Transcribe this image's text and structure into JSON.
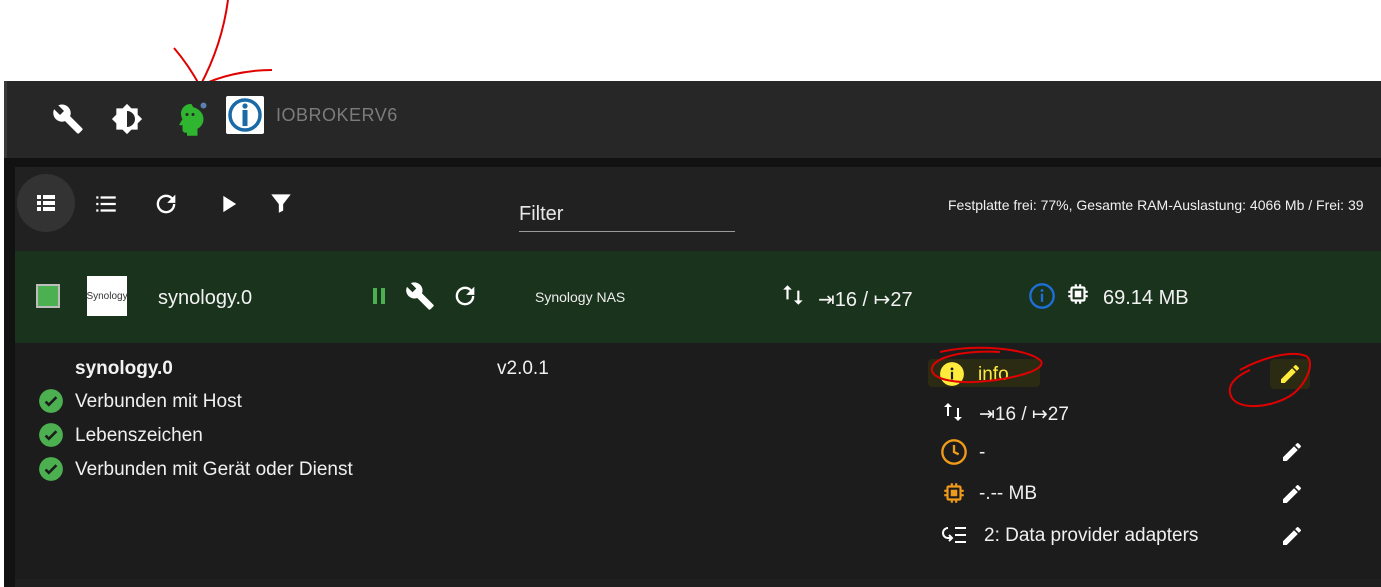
{
  "header": {
    "title": "IOBROKERV6",
    "icons": [
      "wrench-icon",
      "brightness-icon",
      "expert-mode-head-icon",
      "iobroker-logo-icon"
    ]
  },
  "toolbar": {
    "filter_label": "Filter",
    "status_text": "Festplatte frei: 77%, Gesamte RAM-Auslastung: 4066 Mb / Frei: 39"
  },
  "adapter": {
    "logo_text": "Synology",
    "name": "synology.0",
    "title": "Synology NAS",
    "events": "⇥16 / ↦27",
    "memory": "69.14 MB"
  },
  "details": {
    "instance": "synology.0",
    "version": "v2.0.1",
    "checks": [
      "Verbunden mit Host",
      "Lebenszeichen",
      "Verbunden mit Gerät oder Dienst"
    ],
    "loglevel": "info",
    "events": "⇥16 / ↦27",
    "schedule": "-",
    "ram_limit": "-.-- MB",
    "tier": "2: Data provider adapters"
  },
  "colors": {
    "accent_green": "#4caf50",
    "active_row": "#1a331c",
    "highlight_yellow": "#ffeb3b",
    "orange": "#ef9a1a",
    "annotation_red": "#e00000",
    "info_blue": "#1e6fd9"
  }
}
